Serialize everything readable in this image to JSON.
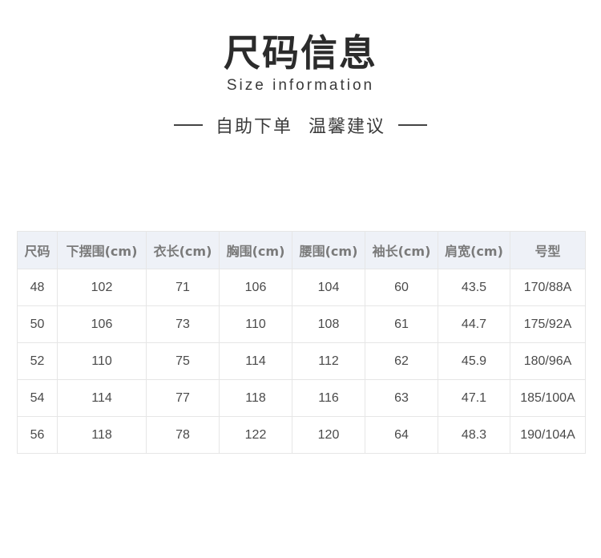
{
  "header": {
    "title": "尺码信息",
    "subtitle": "Size information",
    "tagline_left": "自助下单",
    "tagline_right": "温馨建议"
  },
  "table": {
    "columns": [
      "尺码",
      "下摆围(cm)",
      "衣长(cm)",
      "胸围(cm)",
      "腰围(cm)",
      "袖长(cm)",
      "肩宽(cm)",
      "号型"
    ],
    "rows": [
      [
        "48",
        "102",
        "71",
        "106",
        "104",
        "60",
        "43.5",
        "170/88A"
      ],
      [
        "50",
        "106",
        "73",
        "110",
        "108",
        "61",
        "44.7",
        "175/92A"
      ],
      [
        "52",
        "110",
        "75",
        "114",
        "112",
        "62",
        "45.9",
        "180/96A"
      ],
      [
        "54",
        "114",
        "77",
        "118",
        "116",
        "63",
        "47.1",
        "185/100A"
      ],
      [
        "56",
        "118",
        "78",
        "122",
        "120",
        "64",
        "48.3",
        "190/104A"
      ]
    ]
  }
}
